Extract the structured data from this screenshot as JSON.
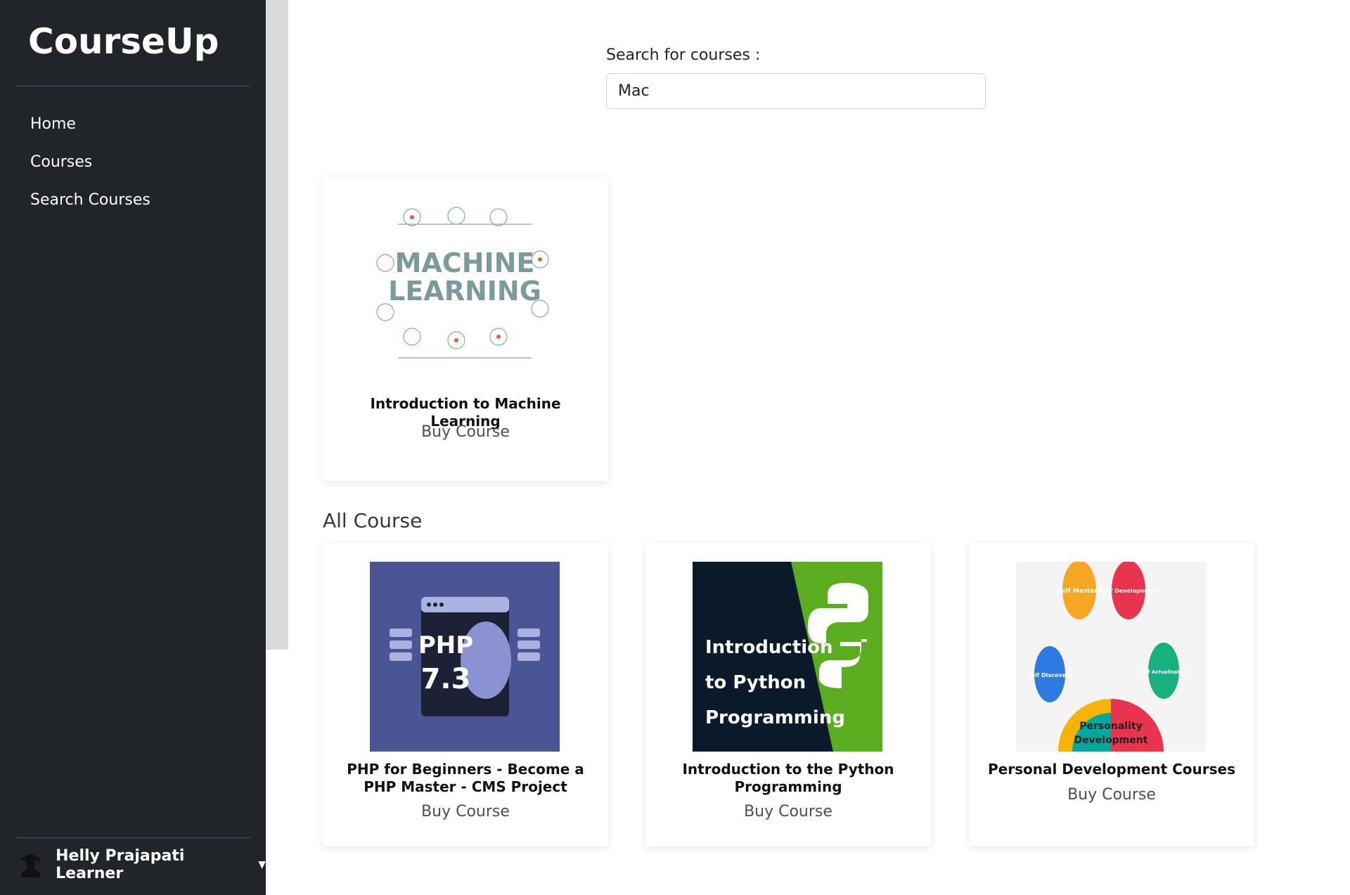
{
  "sidebar": {
    "brand": "CourseUp",
    "items": [
      {
        "label": "Home"
      },
      {
        "label": "Courses"
      },
      {
        "label": "Search Courses"
      }
    ],
    "user": {
      "name": "Helly Prajapati Learner",
      "icon": "graduate-avatar-icon"
    }
  },
  "search": {
    "label": "Search for courses :",
    "value": "Mac"
  },
  "results": [
    {
      "title": "Introduction to Machine Learning",
      "action": "Buy Course",
      "thumb_text": [
        "MACHINE",
        "LEARNING"
      ]
    }
  ],
  "all_courses": {
    "heading": "All Course",
    "items": [
      {
        "title": "PHP for Beginners - Become a PHP Master - CMS Project",
        "action": "Buy Course",
        "thumb_text": [
          "PHP",
          "7.3"
        ]
      },
      {
        "title": "Introduction to the Python Programming",
        "action": "Buy Course",
        "thumb_text": [
          "Introduction",
          "to Python",
          "Programming"
        ]
      },
      {
        "title": "Personal Development Courses",
        "action": "Buy Course",
        "thumb_text": [
          "Self Mastery",
          "Self Development",
          "Self Discovery",
          "Self Actualisation",
          "Personality",
          "Development"
        ]
      }
    ]
  },
  "colors": {
    "sidebar_bg": "#212529",
    "php_bg": "#4a5596",
    "python_bg": "#0b1a2b",
    "python_green": "#5aad1e",
    "ml_text": "#7a9a9c"
  }
}
